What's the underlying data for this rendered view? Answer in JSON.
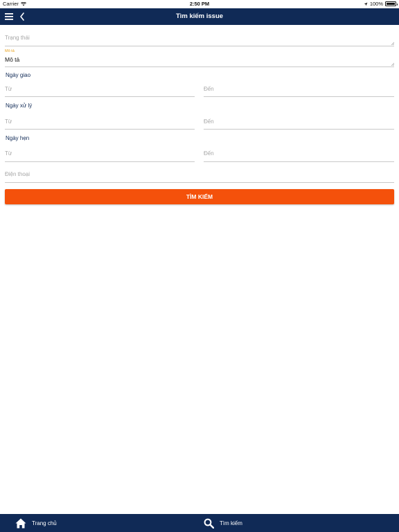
{
  "status_bar": {
    "carrier": "Carrier",
    "time": "2:50 PM",
    "battery": "100%"
  },
  "nav": {
    "title": "Tìm kiếm issue",
    "icons": [
      "menu-icon",
      "chevron-left-icon"
    ]
  },
  "form": {
    "trang_thai": {
      "placeholder": "Trạng thái",
      "value": ""
    },
    "mo_ta": {
      "label": "Mô tả",
      "value": "Mô tả"
    },
    "ngay_giao": {
      "label": "Ngày giao",
      "from_placeholder": "Từ",
      "to_placeholder": "Đến"
    },
    "ngay_xu_ly": {
      "label": "Ngày xử lý",
      "from_placeholder": "Từ",
      "to_placeholder": "Đến"
    },
    "ngay_hen": {
      "label": "Ngày hẹn",
      "from_placeholder": "Từ",
      "to_placeholder": "Đến"
    },
    "dien_thoai": {
      "placeholder": "Điện thoại",
      "value": ""
    },
    "search_button": "TÌM KIẾM"
  },
  "tab_bar": {
    "items": [
      {
        "label": "Trang chủ",
        "icon": "home-icon"
      },
      {
        "label": "Tìm kiếm",
        "icon": "search-icon"
      }
    ]
  },
  "colors": {
    "nav": "#102a56",
    "accent_button": "#f4510b",
    "section_label": "#102a56",
    "float_label": "#e8a01a"
  }
}
